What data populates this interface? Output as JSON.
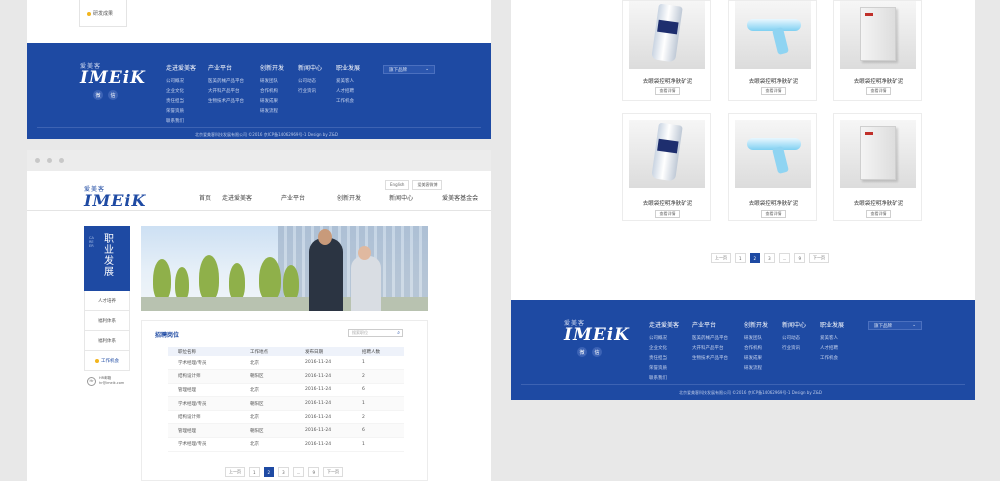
{
  "brand": {
    "cn": "爱美客",
    "en": "IMEiK"
  },
  "top_frame": {
    "side_active_item": "研发成果"
  },
  "footer": {
    "columns": [
      {
        "title": "走进爱美客",
        "items": [
          "公司概况",
          "企业文化",
          "责任担当",
          "荣誉资质",
          "联系我们"
        ]
      },
      {
        "title": "产业平台",
        "items": [
          "医美药械产品平台",
          "大开科产品平台",
          "生物技术产品平台"
        ]
      },
      {
        "title": "创新开发",
        "items": [
          "研发团队",
          "合作机构",
          "研发成果",
          "研发流程"
        ]
      },
      {
        "title": "新闻中心",
        "items": [
          "公司动态",
          "行业资讯"
        ]
      },
      {
        "title": "职业发展",
        "items": [
          "爱美客人",
          "人才招聘",
          "工作机会"
        ]
      }
    ],
    "link_select": "旗下品牌",
    "social_icons": [
      "weibo-icon",
      "wechat-icon"
    ],
    "social_glyphs": [
      "微",
      "信"
    ],
    "copyright": "北京爱美客科技发展有限公司 ©2016 京ICP备14062969号-1    Design by Z&D"
  },
  "page": {
    "langs": [
      "English",
      "爱美客微博"
    ],
    "nav": [
      "首页",
      "走进爱美客",
      "产业平台",
      "创新开发",
      "新闻中心",
      "爱美客基金会",
      "职业发展"
    ],
    "nav_active": "职业发展",
    "side_title": "职业发展",
    "side_title_en": "CAREER",
    "side_menu": [
      "人才培养",
      "福利体系",
      "福利体系",
      "工作机会"
    ],
    "side_menu_active": "工作机会",
    "contact": {
      "icon": "Hr",
      "label": "HR邮箱",
      "email": "hr@imeik.com"
    },
    "jobs": {
      "title": "招聘岗位",
      "search_placeholder": "搜索职位",
      "columns": [
        "职位名称",
        "工作地点",
        "发布日期",
        "招聘人数"
      ],
      "rows": [
        [
          "学术经理/专员",
          "北京",
          "2016-11-24",
          "1"
        ],
        [
          "结构设计师",
          "朝阳区",
          "2016-11-24",
          "2"
        ],
        [
          "管理经理",
          "北京",
          "2016-11-24",
          "6"
        ],
        [
          "学术经理/专员",
          "朝阳区",
          "2016-11-24",
          "1"
        ],
        [
          "结构设计师",
          "北京",
          "2016-11-24",
          "2"
        ],
        [
          "管理经理",
          "朝阳区",
          "2016-11-24",
          "6"
        ],
        [
          "学术经理/专员",
          "北京",
          "2016-11-24",
          "1"
        ]
      ]
    },
    "pager": [
      "上一页",
      "1",
      "2",
      "3",
      "...",
      "9",
      "下一页"
    ],
    "pager_active": "2"
  },
  "products": {
    "items": [
      {
        "name": "去眼袋控明净肤矿泥",
        "kind": "tube"
      },
      {
        "name": "去眼袋控明净肤矿泥",
        "kind": "gun"
      },
      {
        "name": "去眼袋控明净肤矿泥",
        "kind": "box"
      },
      {
        "name": "去眼袋控明净肤矿泥",
        "kind": "tube"
      },
      {
        "name": "去眼袋控明净肤矿泥",
        "kind": "gun"
      },
      {
        "name": "去眼袋控明净肤矿泥",
        "kind": "box"
      }
    ],
    "detail_label": "查看详情",
    "pager": [
      "上一页",
      "1",
      "2",
      "3",
      "...",
      "9",
      "下一页"
    ],
    "pager_active": "2"
  },
  "colors": {
    "brand_blue": "#1e4aa3",
    "accent_yellow": "#f2b51d"
  }
}
